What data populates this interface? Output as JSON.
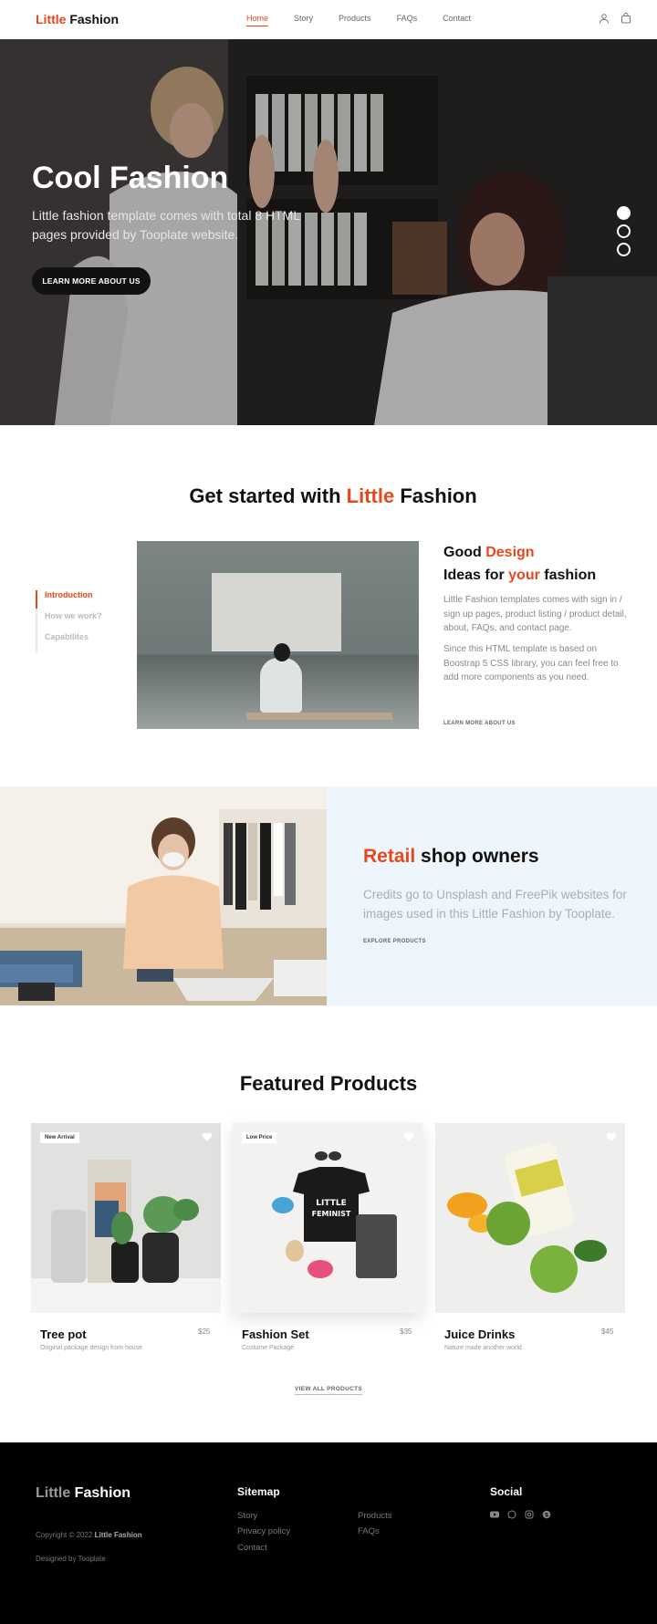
{
  "nav": {
    "brand_accent": "Little",
    "brand_rest": " Fashion",
    "links": [
      "Home",
      "Story",
      "Products",
      "FAQs",
      "Contact"
    ],
    "active": "Home",
    "icons": [
      "user-icon",
      "bag-icon"
    ]
  },
  "hero": {
    "title": "Cool Fashion",
    "subtitle": "Little fashion template comes with total 8 HTML pages provided by Tooplate website.",
    "button": "LEARN MORE ABOUT US",
    "slides": 3,
    "active_slide": 1
  },
  "get_started": {
    "title_start": "Get started with ",
    "title_accent": "Little",
    "title_end": " Fashion",
    "tabs": [
      "Introduction",
      "How we work?",
      "Capabilites"
    ],
    "active_tab": "Introduction",
    "heading_line1_start": "Good ",
    "heading_line1_accent": "Design",
    "heading_line2_start": "Ideas for ",
    "heading_line2_accent": "your",
    "heading_line2_end": " fashion",
    "para1": "Little Fashion templates comes with sign in / sign up pages, product listing / product detail, about, FAQs, and contact page.",
    "para2": "Since this HTML template is based on Boostrap 5 CSS library, you can feel free to add more components as you need.",
    "link": "LEARN MORE ABOUT US"
  },
  "retail": {
    "title_accent": "Retail",
    "title_rest": " shop owners",
    "paragraph": "Credits go to Unsplash and FreePik websites for images used in this Little Fashion by Tooplate.",
    "link": "EXPLORE PRODUCTS"
  },
  "featured": {
    "title": "Featured Products",
    "products": [
      {
        "name": "Tree pot",
        "price": "$25",
        "desc": "Original package design from house",
        "badge": "New Arrival"
      },
      {
        "name": "Fashion Set",
        "price": "$35",
        "desc": "Costume Package",
        "badge": "Low Price"
      },
      {
        "name": "Juice Drinks",
        "price": "$45",
        "desc": "Nature made another world",
        "badge": ""
      }
    ],
    "view_all": "VIEW ALL PRODUCTS"
  },
  "footer": {
    "brand_grey": "Little",
    "brand_rest": " Fashion",
    "copyright_text": "Copyright © 2022 ",
    "copyright_brand": "Little Fashion",
    "designed": "Designed by Tooplate",
    "sitemap_title": "Sitemap",
    "sitemap_col1": [
      "Story",
      "Privacy policy",
      "Contact"
    ],
    "sitemap_col2": [
      "Products",
      "FAQs"
    ],
    "social_title": "Social",
    "social_icons": [
      "youtube-icon",
      "whatsapp-icon",
      "instagram-icon",
      "skype-icon"
    ]
  },
  "colors": {
    "accent": "#e8471a",
    "dark": "#111111",
    "retail_panel": "#eef6fd",
    "footer_bg": "#000000"
  }
}
